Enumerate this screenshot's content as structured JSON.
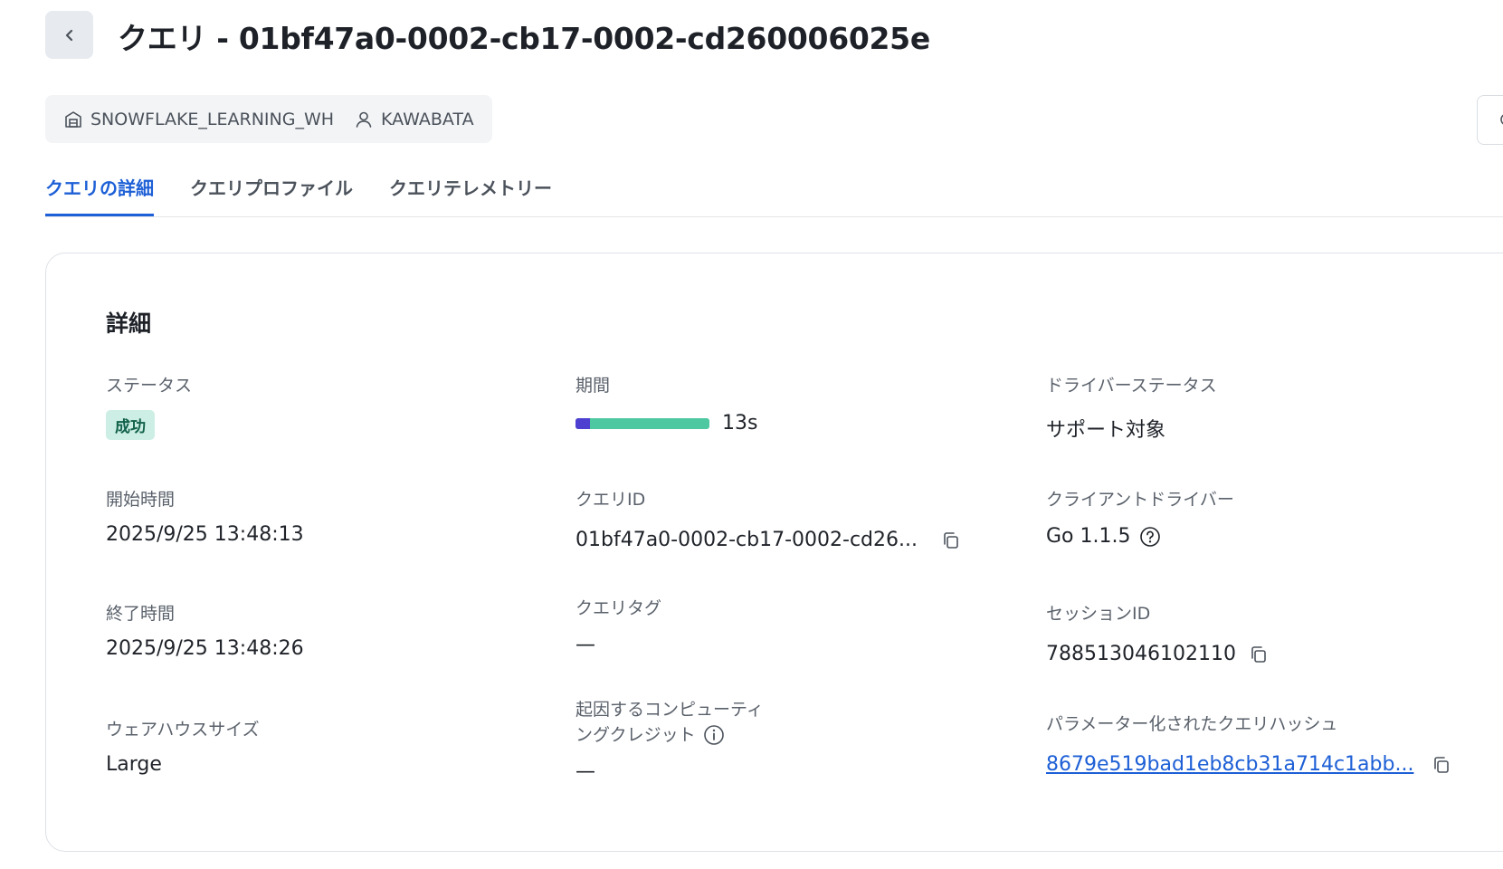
{
  "header": {
    "title": "クエリ - 01bf47a0-0002-cb17-0002-cd260006025e",
    "back_icon": "chevron-left-icon"
  },
  "meta": {
    "warehouse": "SNOWFLAKE_LEARNING_WH",
    "user": "KAWABATA"
  },
  "tabs": [
    {
      "label": "クエリの詳細",
      "active": true
    },
    {
      "label": "クエリプロファイル",
      "active": false
    },
    {
      "label": "クエリテレメトリー",
      "active": false
    }
  ],
  "details": {
    "title": "詳細",
    "status": {
      "label": "ステータス",
      "value": "成功"
    },
    "start_time": {
      "label": "開始時間",
      "value": "2025/9/25 13:48:13"
    },
    "end_time": {
      "label": "終了時間",
      "value": "2025/9/25 13:48:26"
    },
    "warehouse_size": {
      "label": "ウェアハウスサイズ",
      "value": "Large"
    },
    "duration": {
      "label": "期間",
      "value": "13s",
      "compile_fraction": 0.11
    },
    "query_id": {
      "label": "クエリID",
      "value": "01bf47a0-0002-cb17-0002-cd26..."
    },
    "query_tag": {
      "label": "クエリタグ",
      "value": "—"
    },
    "compute_credits": {
      "label_line1": "起因するコンピューティ",
      "label_line2": "ングクレジット",
      "value": "—"
    },
    "driver_status": {
      "label": "ドライバーステータス",
      "value": "サポート対象"
    },
    "client_driver": {
      "label": "クライアントドライバー",
      "value": "Go 1.1.5"
    },
    "session_id": {
      "label": "セッションID",
      "value": "788513046102110"
    },
    "param_hash": {
      "label": "パラメーター化されたクエリハッシュ",
      "value": "8679e519bad1eb8cb31a714c1abb..."
    }
  },
  "colors": {
    "accent": "#1d5fd6",
    "success_bg": "#cdeee4",
    "duration_exec": "#4dc8a0",
    "duration_compile": "#4d3fd0"
  }
}
